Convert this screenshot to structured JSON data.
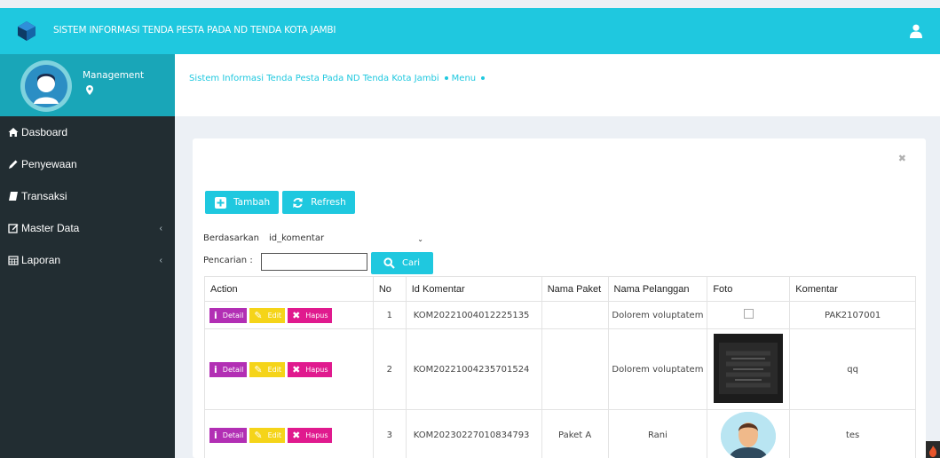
{
  "app": {
    "title": "SISTEM INFORMASI TENDA PESTA PADA ND TENDA KOTA JAMBI"
  },
  "user_panel": {
    "role": "Management"
  },
  "sidebar": {
    "items": [
      {
        "label": "Dasboard",
        "icon": "home-icon",
        "has_submenu": false
      },
      {
        "label": "Penyewaan",
        "icon": "pencil-icon",
        "has_submenu": false
      },
      {
        "label": "Transaksi",
        "icon": "book-icon",
        "has_submenu": false
      },
      {
        "label": "Master Data",
        "icon": "edit-icon",
        "has_submenu": true
      },
      {
        "label": "Laporan",
        "icon": "calendar-icon",
        "has_submenu": true
      }
    ]
  },
  "breadcrumb": {
    "items": [
      "Sistem Informasi Tenda Pesta Pada ND Tenda Kota Jambi",
      "Menu"
    ]
  },
  "toolbar": {
    "add_label": "Tambah",
    "refresh_label": "Refresh"
  },
  "filter": {
    "label": "Berdasarkan:",
    "selected": "id_komentar"
  },
  "search": {
    "label": "Pencarian :",
    "value": "",
    "button_label": "Cari"
  },
  "table": {
    "headers": [
      "Action",
      "No",
      "Id Komentar",
      "Nama Paket",
      "Nama Pelanggan",
      "Foto",
      "Komentar"
    ],
    "actions": {
      "detail": "Detail",
      "edit": "Edit",
      "hapus": "Hapus"
    },
    "rows": [
      {
        "no": "1",
        "id": "KOM20221004012225135",
        "paket": "",
        "pelanggan": "Dolorem voluptatem",
        "foto": "empty",
        "komentar": "PAK2107001"
      },
      {
        "no": "2",
        "id": "KOM20221004235701524",
        "paket": "",
        "pelanggan": "Dolorem voluptatem",
        "foto": "scramble-image",
        "komentar": "qq"
      },
      {
        "no": "3",
        "id": "KOM20230227010834793",
        "paket": "Paket A",
        "pelanggan": "Rani",
        "foto": "person-avatar",
        "komentar": "tes"
      }
    ]
  },
  "colors": {
    "primary": "#1fc8df",
    "sidebar": "#222d32",
    "detail": "#b22fb4",
    "edit": "#f5d419",
    "hapus": "#e01a8e"
  }
}
